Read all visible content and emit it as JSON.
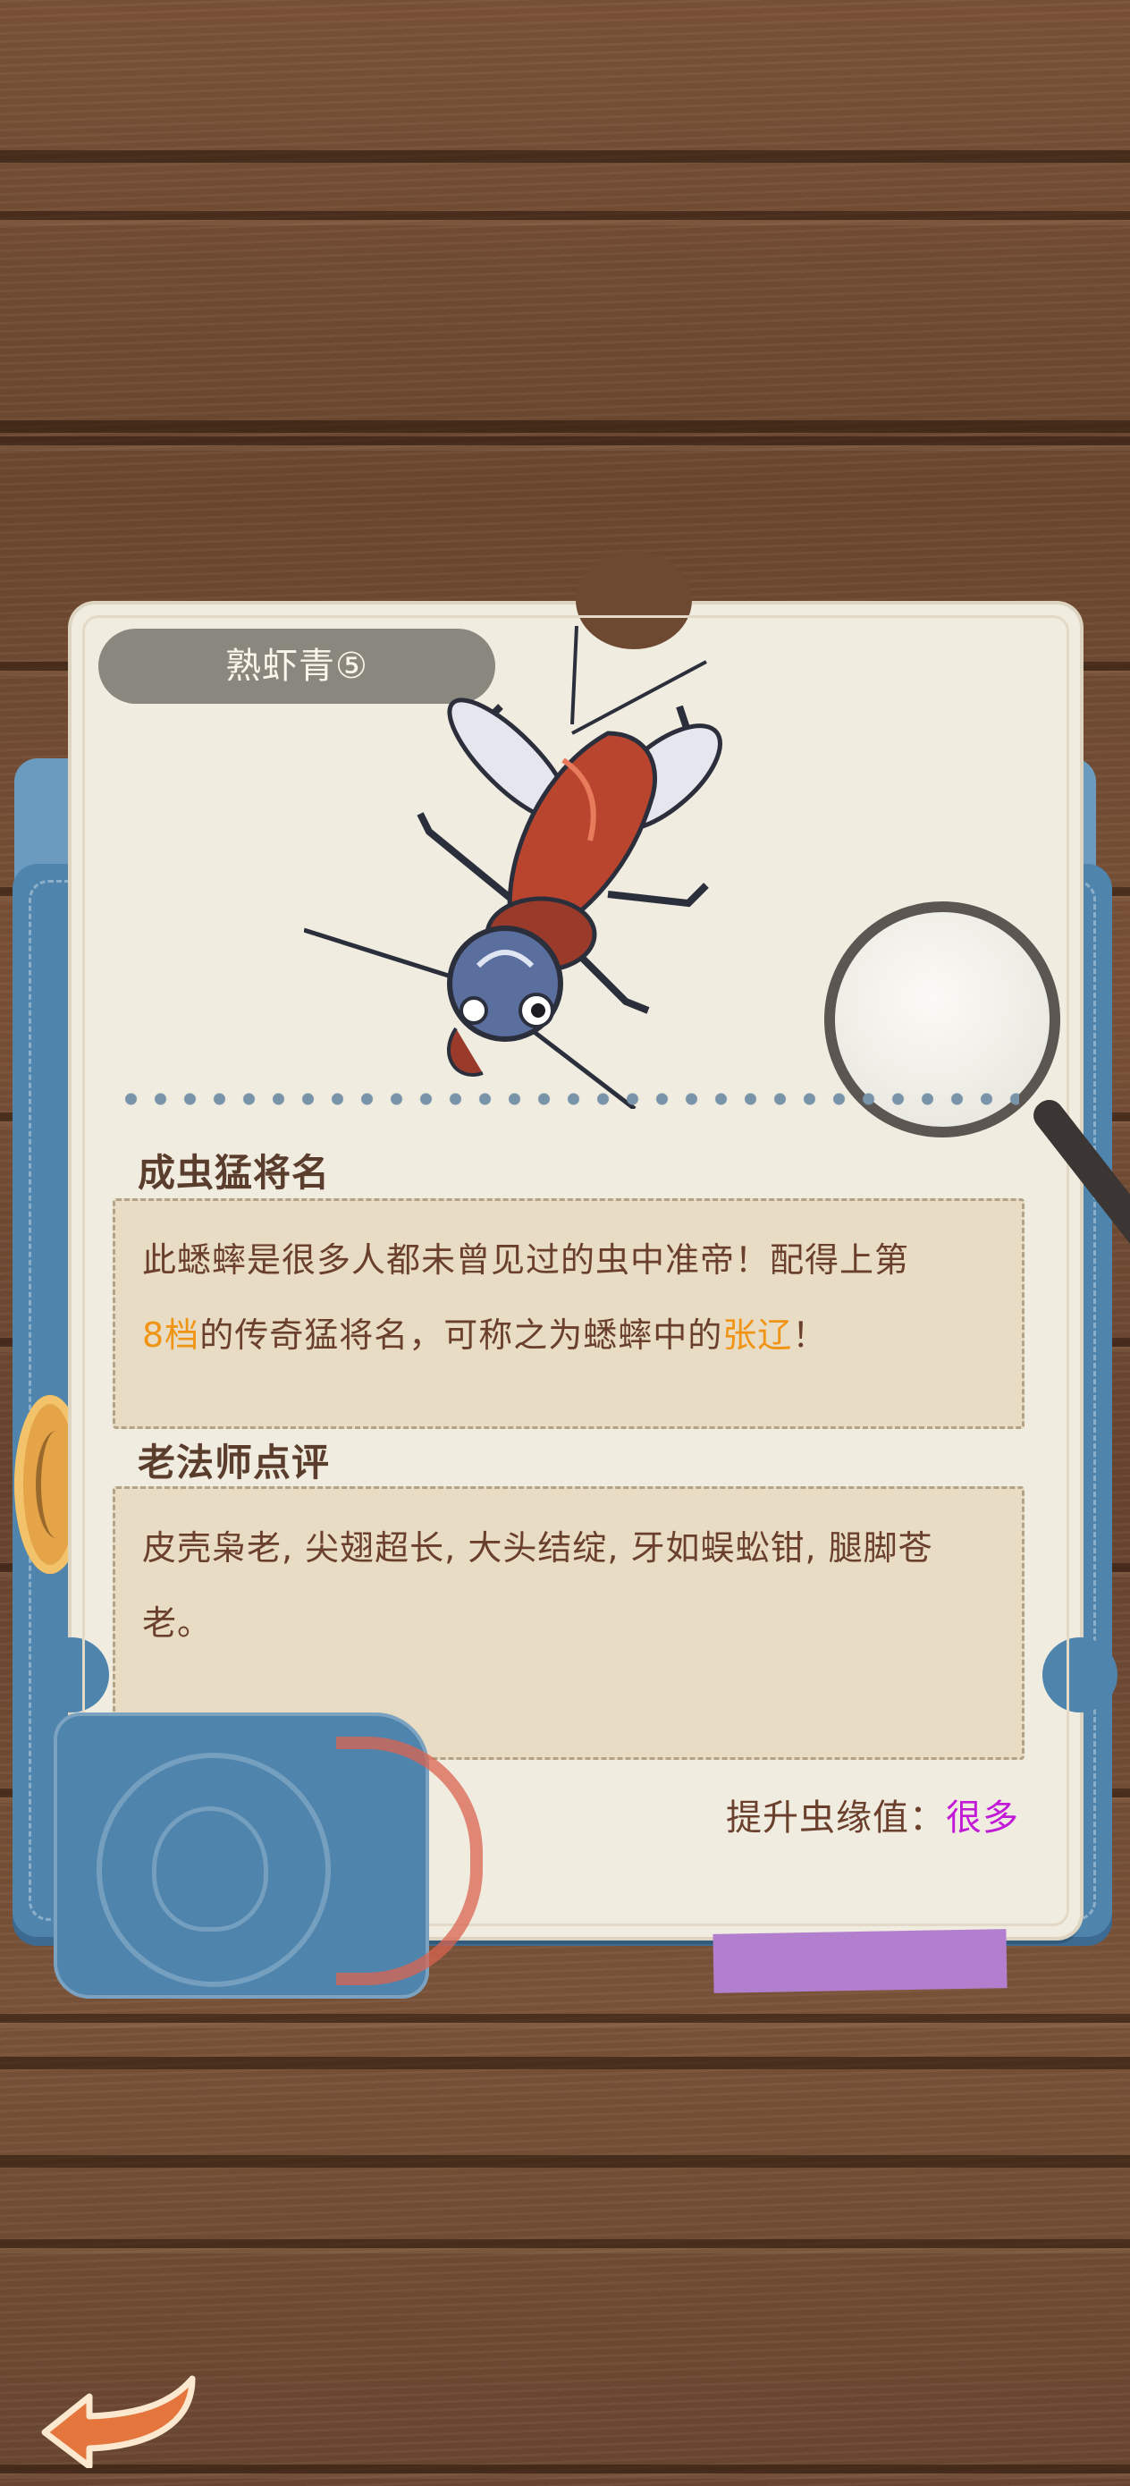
{
  "card": {
    "insect_name": "熟虾青⑤"
  },
  "adult_general": {
    "title": "成虫猛将名",
    "line1": "此蟋蟀是很多人都未曾见过的虫中准帝！配得上第",
    "line2_highlight1": "8档",
    "line2_mid": "的传奇猛将名，可称之为蟋蟀中的",
    "line2_highlight2": "张辽",
    "line2_end": "！"
  },
  "master_review": {
    "title": "老法师点评",
    "line1": "皮壳枭老, 尖翅超长, 大头结绽, 牙如蜈蚣钳, 腿脚苍",
    "line2": "老。"
  },
  "reward": {
    "label": "提升虫缘值：",
    "value": "很多"
  },
  "icons": {
    "back": "back-arrow-icon",
    "magnifier": "magnifier-icon",
    "cricket": "cricket-image",
    "seal": "master-seal-stamp",
    "medal": "medal-icon"
  },
  "colors": {
    "highlight_orange": "#f09415",
    "reward_purple": "#c21bd8",
    "text_brown": "#6a3f2b",
    "pill_gray": "#8a877e"
  }
}
